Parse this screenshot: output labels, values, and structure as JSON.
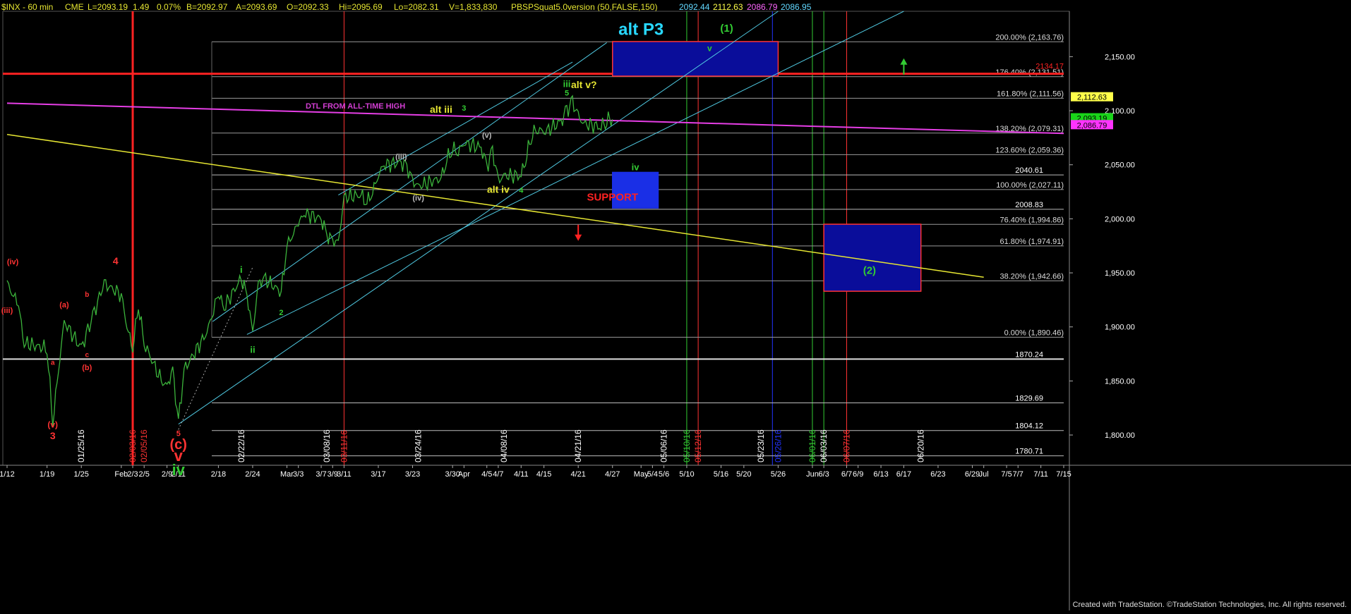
{
  "header": {
    "symbol": "$INX - 60 min",
    "exchange": "CME",
    "last": "L=2093.19",
    "change": "1.49",
    "change_pct": "0.07%",
    "bid": "B=2092.97",
    "ask": "A=2093.69",
    "open": "O=2092.33",
    "high": "Hi=2095.69",
    "low": "Lo=2082.31",
    "volume": "V=1,833,830",
    "indicator": "PBSPSquat5.0version (50,FALSE,150)",
    "values": [
      "2092.44",
      "2112.63",
      "2086.79",
      "2086.95"
    ],
    "value_colors": [
      "#62d8ff",
      "#ffff4a",
      "#ff66ff",
      "#62d8ff"
    ]
  },
  "footer": {
    "credit": "Created with TradeStation. ©TradeStation Technologies, Inc. All rights reserved."
  },
  "chart_data": {
    "type": "line",
    "title": "$INX - 60 min",
    "y_axis": {
      "ticks": [
        "2,150.00",
        "2,100.00",
        "2,050.00",
        "2,000.00",
        "1,950.00",
        "1,900.00",
        "1,850.00",
        "1,800.00"
      ],
      "ylim": [
        1772,
        2192
      ]
    },
    "x_axis": {
      "ticks": [
        "1/12",
        "1/19",
        "1/25",
        "Feb",
        "2/3",
        "2/5",
        "2/9",
        "2/11",
        "2/18",
        "2/24",
        "Mar",
        "3/3",
        "3/7",
        "3/9",
        "3/11",
        "3/17",
        "3/23",
        "3/30",
        "Apr",
        "4/5",
        "4/7",
        "4/11",
        "4/15",
        "4/21",
        "4/27",
        "May",
        "5/4",
        "5/6",
        "5/10",
        "5/16",
        "5/20",
        "5/26",
        "Jun",
        "6/3",
        "6/7",
        "6/9",
        "6/13",
        "6/17",
        "6/23",
        "6/29",
        "Jul",
        "7/5",
        "7/7",
        "7/11",
        "7/15"
      ]
    },
    "price_series": {
      "color": "#3bb33b",
      "anchors": [
        [
          "1/12",
          1940
        ],
        [
          "1/14",
          1920
        ],
        [
          "1/15",
          1885
        ],
        [
          "1/19",
          1880
        ],
        [
          "1/20",
          1812
        ],
        [
          "1/21",
          1860
        ],
        [
          "1/22",
          1905
        ],
        [
          "1/25",
          1880
        ],
        [
          "1/27",
          1910
        ],
        [
          "1/29",
          1940
        ],
        [
          "2/1",
          1930
        ],
        [
          "2/2",
          1900
        ],
        [
          "2/3",
          1880
        ],
        [
          "2/4",
          1920
        ],
        [
          "2/5",
          1885
        ],
        [
          "2/8",
          1850
        ],
        [
          "2/9",
          1845
        ],
        [
          "2/10",
          1860
        ],
        [
          "2/11",
          1812
        ],
        [
          "2/12",
          1860
        ],
        [
          "2/16",
          1895
        ],
        [
          "2/18",
          1930
        ],
        [
          "2/19",
          1918
        ],
        [
          "2/22",
          1945
        ],
        [
          "2/23",
          1930
        ],
        [
          "2/24",
          1895
        ],
        [
          "2/25",
          1940
        ],
        [
          "2/26",
          1945
        ],
        [
          "2/29",
          1932
        ],
        [
          "3/1",
          1975
        ],
        [
          "3/3",
          1995
        ],
        [
          "3/4",
          2005
        ],
        [
          "3/7",
          2000
        ],
        [
          "3/8",
          1985
        ],
        [
          "3/9",
          1980
        ],
        [
          "3/10",
          1978
        ],
        [
          "3/11",
          2020
        ],
        [
          "3/14",
          2022
        ],
        [
          "3/15",
          2015
        ],
        [
          "3/16",
          2025
        ],
        [
          "3/17",
          2040
        ],
        [
          "3/18",
          2050
        ],
        [
          "3/21",
          2052
        ],
        [
          "3/22",
          2048
        ],
        [
          "3/23",
          2035
        ],
        [
          "3/24",
          2030
        ],
        [
          "3/28",
          2038
        ],
        [
          "3/29",
          2055
        ],
        [
          "3/30",
          2065
        ],
        [
          "3/31",
          2062
        ],
        [
          "4/1",
          2070
        ],
        [
          "4/4",
          2066
        ],
        [
          "4/5",
          2048
        ],
        [
          "4/6",
          2063
        ],
        [
          "4/7",
          2035
        ],
        [
          "4/8",
          2040
        ],
        [
          "4/11",
          2040
        ],
        [
          "4/12",
          2060
        ],
        [
          "4/13",
          2080
        ],
        [
          "4/14",
          2083
        ],
        [
          "4/15",
          2080
        ],
        [
          "4/18",
          2090
        ],
        [
          "4/19",
          2100
        ],
        [
          "4/20",
          2108
        ],
        [
          "4/21",
          2095
        ],
        [
          "4/22",
          2088
        ],
        [
          "4/25",
          2085
        ],
        [
          "4/26",
          2092
        ],
        [
          "4/27",
          2092
        ]
      ]
    },
    "fib_levels": [
      {
        "label": "200.00% (2,163.76)",
        "value": 2163.76
      },
      {
        "label": "176.40% (2,131.51)",
        "value": 2131.51
      },
      {
        "label": "161.80% (2,111.56)",
        "value": 2111.56
      },
      {
        "label": "138.20% (2,079.31)",
        "value": 2079.31
      },
      {
        "label": "123.60% (2,059.36)",
        "value": 2059.36
      },
      {
        "label": "100.00% (2,027.11)",
        "value": 2027.11
      },
      {
        "label": "76.40% (1,994.86)",
        "value": 1994.86
      },
      {
        "label": "61.80% (1,974.91)",
        "value": 1974.91
      },
      {
        "label": "38.20% (1,942.66)",
        "value": 1942.66
      },
      {
        "label": "0.00% (1,890.46)",
        "value": 1890.46
      }
    ],
    "horizontal_levels": [
      {
        "label": "2040.61",
        "value": 2040.61
      },
      {
        "label": "2008.83",
        "value": 2008.83
      },
      {
        "label": "1870.24",
        "value": 1870.24
      },
      {
        "label": "1829.69",
        "value": 1829.69
      },
      {
        "label": "1804.12",
        "value": 1804.12
      },
      {
        "label": "1780.71",
        "value": 1780.71
      }
    ],
    "red_level": {
      "label": "2134.17",
      "value": 2134.17
    },
    "price_tags": [
      {
        "label": "2,112.63",
        "value": 2112.63,
        "bg": "#ffff4a",
        "fg": "#000"
      },
      {
        "label": "2,093.19",
        "value": 2093.19,
        "bg": "#19d419",
        "fg": "#000"
      },
      {
        "label": "2,086.79",
        "value": 2086.79,
        "bg": "#ff33ff",
        "fg": "#000"
      }
    ],
    "trendlines": [
      {
        "name": "dtl",
        "color": "#e63ee6",
        "p1": [
          "1/12",
          2107
        ],
        "p2": [
          "7/15",
          2079
        ],
        "width": 2
      },
      {
        "name": "yellow",
        "color": "#e6e632",
        "p1": [
          "1/12",
          2078
        ],
        "p2": [
          "7/1",
          1946
        ],
        "width": 1.5
      }
    ],
    "channel": {
      "color": "#4fc8e0",
      "lines": [
        [
          [
            "2/17",
            1905
          ],
          [
            "4/26",
            2163
          ]
        ],
        [
          [
            "2/11",
            1810
          ],
          [
            "5/26",
            2192
          ]
        ],
        [
          [
            "2/23",
            1893
          ],
          [
            "6/17",
            2192
          ]
        ],
        [
          [
            "3/10",
            2022
          ],
          [
            "4/20",
            2145
          ]
        ]
      ]
    },
    "dotted_line": [
      [
        "2/11",
        1805
      ],
      [
        "2/24",
        1955
      ]
    ],
    "boxes": [
      {
        "name": "top-target",
        "x1": "4/27",
        "x2": "5/26",
        "y1": 2132,
        "y2": 2164,
        "fill": "#0a0d9a",
        "stroke": "#ff3333"
      },
      {
        "name": "support-box",
        "x1": "4/27",
        "x2": "5/5",
        "y1": 2010,
        "y2": 2043,
        "fill": "#1a2fe6",
        "stroke": "#1a2fe6"
      },
      {
        "name": "wave2-target",
        "x1": "6/3",
        "x2": "6/20",
        "y1": 1933,
        "y2": 1995,
        "fill": "#0a0d9a",
        "stroke": "#ff3333"
      }
    ],
    "vertical_lines": [
      {
        "date": "2/3",
        "color": "#ff2222",
        "width": 3
      },
      {
        "date": "3/11",
        "color": "#ff3333",
        "width": 1
      },
      {
        "date": "5/10",
        "color": "#33cc33",
        "width": 1
      },
      {
        "date": "5/12",
        "color": "#ff3333",
        "width": 1
      },
      {
        "date": "5/25",
        "color": "#2233ff",
        "width": 1
      },
      {
        "date": "6/1",
        "color": "#33cc33",
        "width": 1
      },
      {
        "date": "6/3",
        "color": "#33cc33",
        "width": 1
      },
      {
        "date": "6/7",
        "color": "#ff3333",
        "width": 1
      }
    ],
    "date_labels": [
      {
        "text": "01/25/16",
        "date": "1/25",
        "color": "#ffffff"
      },
      {
        "text": "02/03/16",
        "date": "2/3",
        "color": "#ff3333"
      },
      {
        "text": "02/05/16",
        "date": "2/5",
        "color": "#ff3333"
      },
      {
        "text": "02/22/16",
        "date": "2/22",
        "color": "#ffffff"
      },
      {
        "text": "03/08/16",
        "date": "3/8",
        "color": "#ffffff"
      },
      {
        "text": "03/11/16",
        "date": "3/11",
        "color": "#ff3333"
      },
      {
        "text": "03/24/16",
        "date": "3/24",
        "color": "#ffffff"
      },
      {
        "text": "04/08/16",
        "date": "4/8",
        "color": "#ffffff"
      },
      {
        "text": "04/21/16",
        "date": "4/21",
        "color": "#ffffff"
      },
      {
        "text": "05/06/16",
        "date": "5/6",
        "color": "#ffffff"
      },
      {
        "text": "05/10/16",
        "date": "5/10",
        "color": "#33cc33"
      },
      {
        "text": "05/12/16",
        "date": "5/12",
        "color": "#ff3333"
      },
      {
        "text": "05/23/16",
        "date": "5/23",
        "color": "#ffffff"
      },
      {
        "text": "05/26/16",
        "date": "5/26",
        "color": "#2233ff"
      },
      {
        "text": "06/01/16",
        "date": "6/1",
        "color": "#33cc33"
      },
      {
        "text": "06/03/16",
        "date": "6/3",
        "color": "#ffffff"
      },
      {
        "text": "06/07/16",
        "date": "6/7",
        "color": "#ff3333"
      },
      {
        "text": "06/20/16",
        "date": "6/20",
        "color": "#ffffff"
      }
    ],
    "annotations": [
      {
        "text": "(iv)",
        "date": "1/13",
        "value": 1958,
        "color": "#ff3333",
        "size": 11
      },
      {
        "text": "(iii)",
        "date": "1/12",
        "value": 1913,
        "color": "#ff3333",
        "size": 11
      },
      {
        "text": "(a)",
        "date": "1/22",
        "value": 1918,
        "color": "#ff3333",
        "size": 11
      },
      {
        "text": "a",
        "date": "1/20",
        "value": 1865,
        "color": "#ff3333",
        "size": 10
      },
      {
        "text": "b",
        "date": "1/26",
        "value": 1928,
        "color": "#ff3333",
        "size": 10
      },
      {
        "text": "c",
        "date": "1/26",
        "value": 1872,
        "color": "#ff3333",
        "size": 10
      },
      {
        "text": "(b)",
        "date": "1/26",
        "value": 1860,
        "color": "#ff3333",
        "size": 11
      },
      {
        "text": "4",
        "date": "1/31",
        "value": 1958,
        "color": "#ff3333",
        "size": 14
      },
      {
        "text": "(v)",
        "date": "1/20",
        "value": 1807,
        "color": "#ff3333",
        "size": 12
      },
      {
        "text": "3",
        "date": "1/20",
        "value": 1796,
        "color": "#ff3333",
        "size": 14
      },
      {
        "text": "5",
        "date": "2/11",
        "value": 1799,
        "color": "#ff3333",
        "size": 11
      },
      {
        "text": "(c)",
        "date": "2/11",
        "value": 1787,
        "color": "#ff3333",
        "size": 20
      },
      {
        "text": "v",
        "date": "2/11",
        "value": 1776,
        "color": "#ff3333",
        "size": 22
      },
      {
        "text": "iv",
        "date": "2/11",
        "value": 1763,
        "color": "#33cc33",
        "size": 22
      },
      {
        "text": "i",
        "date": "2/22",
        "value": 1950,
        "color": "#33cc33",
        "size": 13
      },
      {
        "text": "ii",
        "date": "2/24",
        "value": 1876,
        "color": "#33cc33",
        "size": 13
      },
      {
        "text": "2",
        "date": "2/29",
        "value": 1911,
        "color": "#33cc33",
        "size": 11
      },
      {
        "text": "(iii)",
        "date": "3/21",
        "value": 2055,
        "color": "#bbbbbb",
        "size": 11
      },
      {
        "text": "(iv)",
        "date": "3/24",
        "value": 2017,
        "color": "#bbbbbb",
        "size": 11
      },
      {
        "text": "(v)",
        "date": "4/5",
        "value": 2075,
        "color": "#bbbbbb",
        "size": 11
      },
      {
        "text": "alt iii",
        "date": "3/28",
        "value": 2098,
        "color": "#e6e632",
        "size": 14
      },
      {
        "text": "3",
        "date": "4/1",
        "value": 2100,
        "color": "#33cc33",
        "size": 11
      },
      {
        "text": "alt iv",
        "date": "4/7",
        "value": 2024,
        "color": "#e6e632",
        "size": 14
      },
      {
        "text": "4",
        "date": "4/11",
        "value": 2024,
        "color": "#33cc33",
        "size": 11
      },
      {
        "text": "iii",
        "date": "4/19",
        "value": 2122,
        "color": "#33cc33",
        "size": 13
      },
      {
        "text": "5",
        "date": "4/19",
        "value": 2114,
        "color": "#33cc33",
        "size": 11
      },
      {
        "text": "alt v?",
        "date": "4/22",
        "value": 2121,
        "color": "#e6e632",
        "size": 14
      },
      {
        "text": "DTL FROM ALL-TIME HIGH",
        "date": "3/13",
        "value": 2102,
        "color": "#d23ed2",
        "size": 11
      },
      {
        "text": "alt  P3",
        "date": "5/2",
        "value": 2170,
        "color": "#28d8ff",
        "size": 24
      },
      {
        "text": "(1)",
        "date": "5/17",
        "value": 2173,
        "color": "#33cc33",
        "size": 15
      },
      {
        "text": "v",
        "date": "5/14",
        "value": 2155,
        "color": "#33cc33",
        "size": 12
      },
      {
        "text": "iv",
        "date": "5/1",
        "value": 2045,
        "color": "#33cc33",
        "size": 13
      },
      {
        "text": "SUPPORT",
        "date": "4/27",
        "value": 2017,
        "color": "#ff2222",
        "size": 15
      },
      {
        "text": "(2)",
        "date": "6/11",
        "value": 1949,
        "color": "#33cc33",
        "size": 15
      }
    ],
    "arrows": [
      {
        "name": "green-up-arrow",
        "date": "6/17",
        "value": 2140,
        "dir": "up",
        "color": "#33cc33"
      },
      {
        "name": "red-down-arrow",
        "date": "4/21",
        "value": 1988,
        "dir": "down",
        "color": "#ff2222"
      }
    ]
  }
}
